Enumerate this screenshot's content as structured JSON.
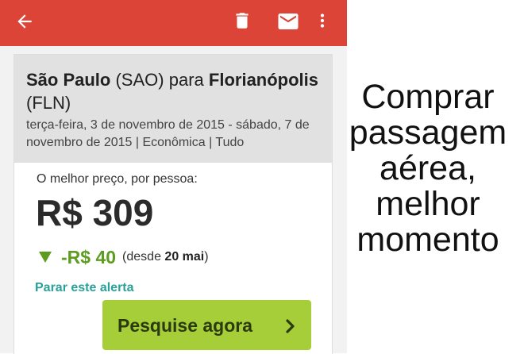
{
  "appbar": {
    "back_icon": "arrow-back-icon",
    "actions": [
      {
        "icon": "trash-icon"
      },
      {
        "icon": "mail-icon"
      },
      {
        "icon": "more-vert-icon"
      }
    ],
    "color": "#db4437"
  },
  "route": {
    "origin_city": "São Paulo",
    "origin_code": "(SAO)",
    "connector": "para",
    "destination_city": "Florianópolis",
    "destination_code": "(FLN)"
  },
  "trip_details": "terça-feira, 3 de novembro de 2015 - sábado, 7 de novembro de 2015 | Econômica | Tudo",
  "price": {
    "label": "O melhor preço, por pessoa:",
    "value": "R$ 309"
  },
  "price_drop": {
    "icon": "triangle-down-icon",
    "amount": "-R$ 40",
    "since_prefix": "(desde",
    "since_date": "20 mai",
    "since_suffix": ")",
    "color": "#5c9c1e"
  },
  "stop_alert_label": "Parar este alerta",
  "search_button": {
    "label": "Pesquise agora",
    "icon": "chevron-right-icon",
    "color": "#a6ce39"
  },
  "caption": "Comprar passagem aérea, melhor momento"
}
